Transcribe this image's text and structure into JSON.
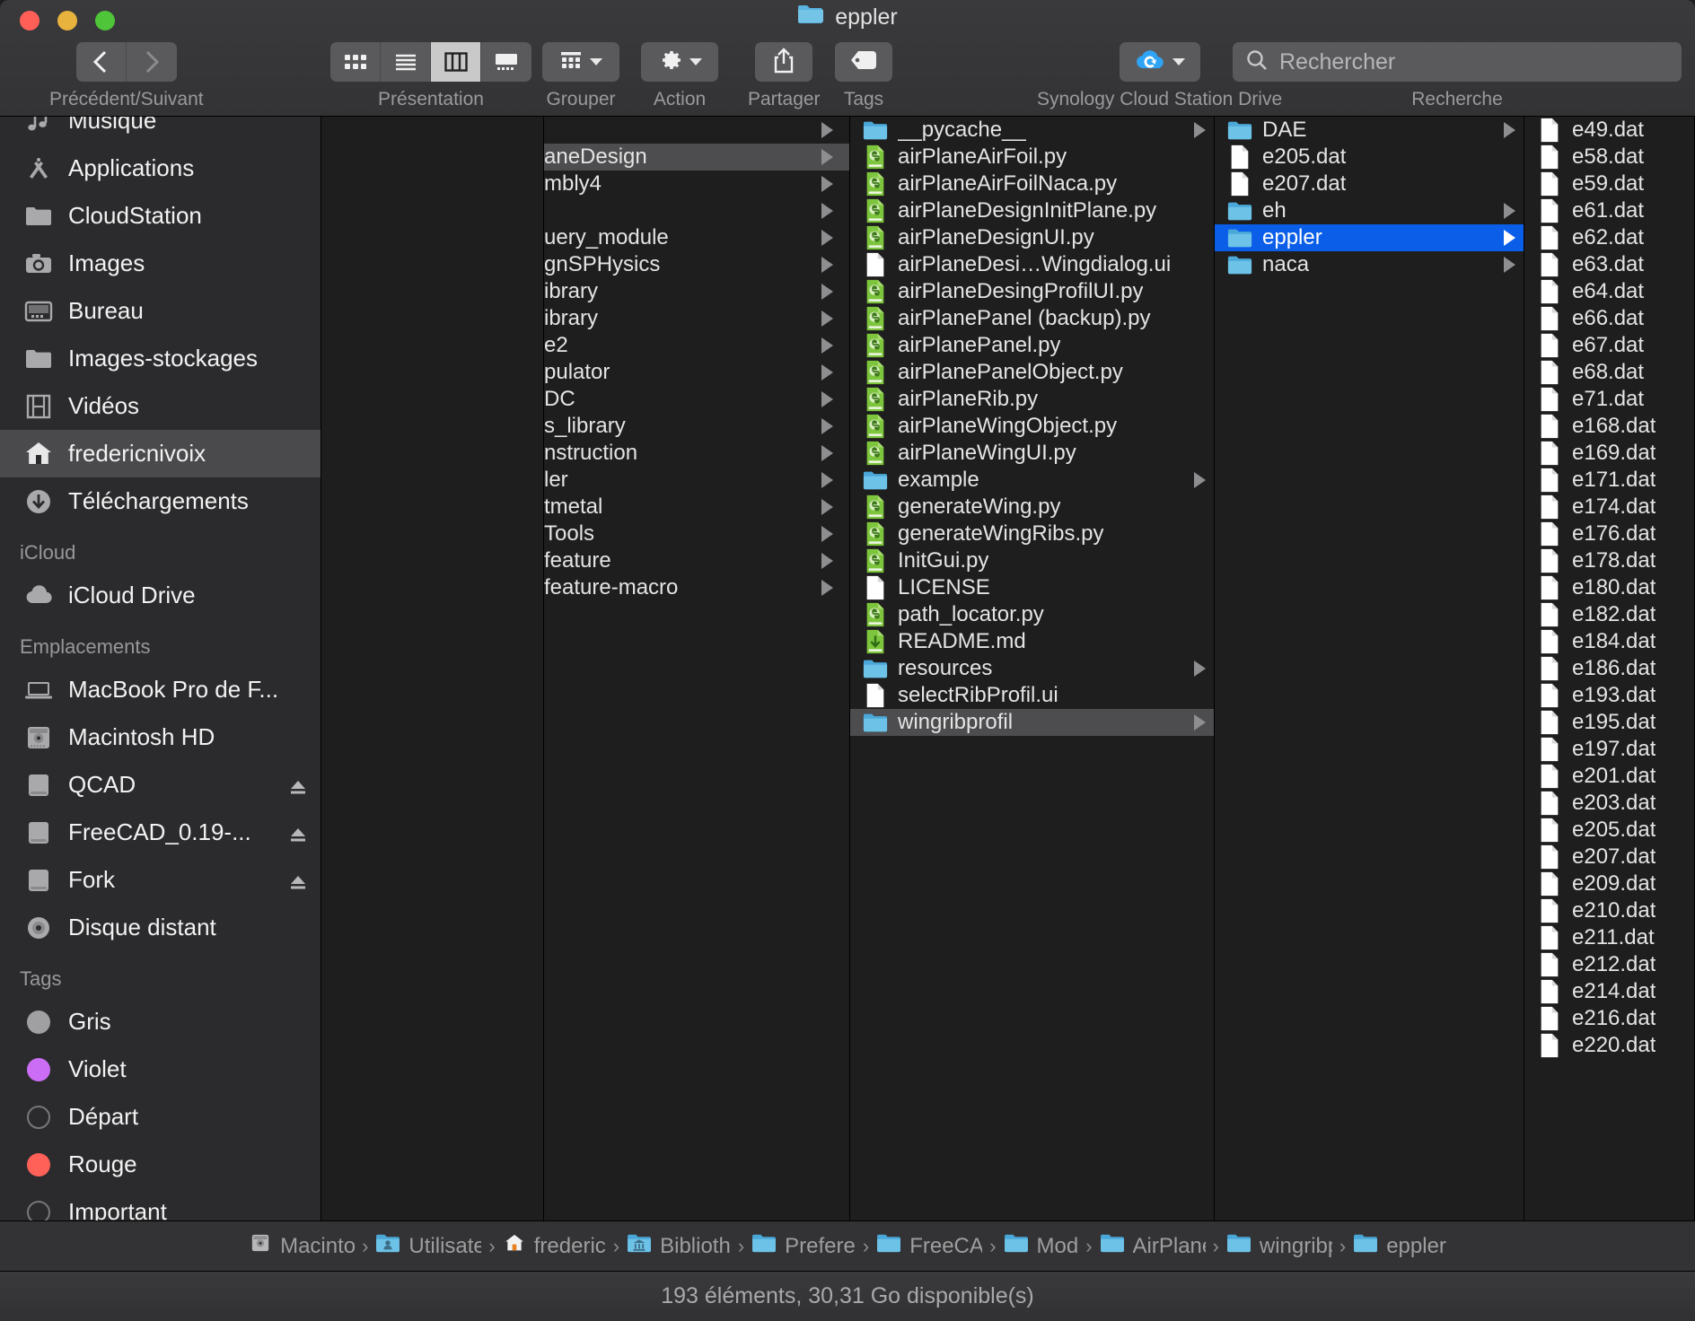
{
  "window": {
    "title": "eppler",
    "title_icon": "folder-icon"
  },
  "toolbar": {
    "nav": {
      "label": "Précédent/Suivant",
      "back_icon": "chevron-left-icon",
      "forward_icon": "chevron-right-icon"
    },
    "view": {
      "label": "Présentation",
      "options": [
        "icon-view",
        "list-view",
        "column-view",
        "gallery-view"
      ],
      "active_index": 2
    },
    "group": {
      "label": "Grouper",
      "icon": "group-grid-icon"
    },
    "action": {
      "label": "Action",
      "icon": "gear-icon"
    },
    "share": {
      "label": "Partager",
      "icon": "share-icon"
    },
    "tags": {
      "label": "Tags",
      "icon": "tag-icon"
    },
    "synology": {
      "label": "Synology Cloud Station Drive",
      "icon": "cloud-sync-icon"
    },
    "search": {
      "label": "Recherche",
      "placeholder": "Rechercher",
      "value": "",
      "icon": "search-icon"
    }
  },
  "sidebar": {
    "favorites": [
      {
        "label": "Musique",
        "icon": "music-icon",
        "selected": false
      },
      {
        "label": "Applications",
        "icon": "applications-icon",
        "selected": false
      },
      {
        "label": "CloudStation",
        "icon": "folder-icon",
        "selected": false
      },
      {
        "label": "Images",
        "icon": "camera-icon",
        "selected": false
      },
      {
        "label": "Bureau",
        "icon": "desktop-icon",
        "selected": false
      },
      {
        "label": "Images-stockages",
        "icon": "folder-icon",
        "selected": false
      },
      {
        "label": "Vidéos",
        "icon": "film-icon",
        "selected": false
      },
      {
        "label": "fredericnivoix",
        "icon": "home-icon",
        "selected": true
      },
      {
        "label": "Téléchargements",
        "icon": "download-icon",
        "selected": false
      }
    ],
    "icloud_header": "iCloud",
    "icloud": [
      {
        "label": "iCloud Drive",
        "icon": "cloud-icon",
        "eject": false
      }
    ],
    "locations_header": "Emplacements",
    "locations": [
      {
        "label": "MacBook Pro de F...",
        "icon": "laptop-icon",
        "eject": false
      },
      {
        "label": "Macintosh HD",
        "icon": "harddisk-icon",
        "eject": false
      },
      {
        "label": "QCAD",
        "icon": "drive-icon",
        "eject": true
      },
      {
        "label": "FreeCAD_0.19-...",
        "icon": "drive-icon",
        "eject": true
      },
      {
        "label": "Fork",
        "icon": "drive-icon",
        "eject": true
      },
      {
        "label": "Disque distant",
        "icon": "disc-icon",
        "eject": false
      }
    ],
    "tags_header": "Tags",
    "tags": [
      {
        "label": "Gris",
        "color": "#a0a0a2"
      },
      {
        "label": "Violet",
        "color": "#cb6ef5"
      },
      {
        "label": "Départ",
        "color": "none"
      },
      {
        "label": "Rouge",
        "color": "#ff6159"
      },
      {
        "label": "Important",
        "color": "none"
      }
    ]
  },
  "columns": [
    {
      "name": "column-1",
      "items": []
    },
    {
      "name": "column-2",
      "items": [
        {
          "label": "",
          "type": "folder",
          "arrow": true,
          "selected": false
        },
        {
          "label": "aneDesign",
          "type": "folder",
          "arrow": true,
          "selected": true
        },
        {
          "label": "mbly4",
          "type": "folder",
          "arrow": true,
          "selected": false
        },
        {
          "label": "",
          "type": "folder",
          "arrow": true,
          "selected": false
        },
        {
          "label": "uery_module",
          "type": "folder",
          "arrow": true,
          "selected": false
        },
        {
          "label": "gnSPHysics",
          "type": "folder",
          "arrow": true,
          "selected": false
        },
        {
          "label": "ibrary",
          "type": "folder",
          "arrow": true,
          "selected": false
        },
        {
          "label": "ibrary",
          "type": "folder",
          "arrow": true,
          "selected": false
        },
        {
          "label": "e2",
          "type": "folder",
          "arrow": true,
          "selected": false
        },
        {
          "label": "pulator",
          "type": "folder",
          "arrow": true,
          "selected": false
        },
        {
          "label": "DC",
          "type": "folder",
          "arrow": true,
          "selected": false
        },
        {
          "label": "s_library",
          "type": "folder",
          "arrow": true,
          "selected": false
        },
        {
          "label": "nstruction",
          "type": "folder",
          "arrow": true,
          "selected": false
        },
        {
          "label": "ler",
          "type": "folder",
          "arrow": true,
          "selected": false
        },
        {
          "label": "tmetal",
          "type": "folder",
          "arrow": true,
          "selected": false
        },
        {
          "label": "Tools",
          "type": "folder",
          "arrow": true,
          "selected": false
        },
        {
          "label": "feature",
          "type": "folder",
          "arrow": true,
          "selected": false
        },
        {
          "label": "feature-macro",
          "type": "folder",
          "arrow": true,
          "selected": false
        }
      ]
    },
    {
      "name": "column-3",
      "items": [
        {
          "label": "__pycache__",
          "type": "folder",
          "arrow": true,
          "selected": false
        },
        {
          "label": "airPlaneAirFoil.py",
          "type": "python",
          "arrow": false,
          "selected": false
        },
        {
          "label": "airPlaneAirFoilNaca.py",
          "type": "python",
          "arrow": false,
          "selected": false
        },
        {
          "label": "airPlaneDesignInitPlane.py",
          "type": "python",
          "arrow": false,
          "selected": false
        },
        {
          "label": "airPlaneDesignUI.py",
          "type": "python",
          "arrow": false,
          "selected": false
        },
        {
          "label": "airPlaneDesi…Wingdialog.ui",
          "type": "doc",
          "arrow": false,
          "selected": false
        },
        {
          "label": "airPlaneDesingProfilUI.py",
          "type": "python",
          "arrow": false,
          "selected": false
        },
        {
          "label": "airPlanePanel (backup).py",
          "type": "python",
          "arrow": false,
          "selected": false
        },
        {
          "label": "airPlanePanel.py",
          "type": "python",
          "arrow": false,
          "selected": false
        },
        {
          "label": "airPlanePanelObject.py",
          "type": "python",
          "arrow": false,
          "selected": false
        },
        {
          "label": "airPlaneRib.py",
          "type": "python",
          "arrow": false,
          "selected": false
        },
        {
          "label": "airPlaneWingObject.py",
          "type": "python",
          "arrow": false,
          "selected": false
        },
        {
          "label": "airPlaneWingUI.py",
          "type": "python",
          "arrow": false,
          "selected": false
        },
        {
          "label": "example",
          "type": "folder",
          "arrow": true,
          "selected": false
        },
        {
          "label": "generateWing.py",
          "type": "python",
          "arrow": false,
          "selected": false
        },
        {
          "label": "generateWingRibs.py",
          "type": "python",
          "arrow": false,
          "selected": false
        },
        {
          "label": "InitGui.py",
          "type": "python",
          "arrow": false,
          "selected": false
        },
        {
          "label": "LICENSE",
          "type": "doc",
          "arrow": false,
          "selected": false
        },
        {
          "label": "path_locator.py",
          "type": "python",
          "arrow": false,
          "selected": false
        },
        {
          "label": "README.md",
          "type": "markdown",
          "arrow": false,
          "selected": false
        },
        {
          "label": "resources",
          "type": "folder",
          "arrow": true,
          "selected": false
        },
        {
          "label": "selectRibProfil.ui",
          "type": "doc",
          "arrow": false,
          "selected": false
        },
        {
          "label": "wingribprofil",
          "type": "folder",
          "arrow": true,
          "selected": true
        }
      ]
    },
    {
      "name": "column-4",
      "items": [
        {
          "label": "DAE",
          "type": "folder",
          "arrow": true,
          "selected": false
        },
        {
          "label": "e205.dat",
          "type": "doc",
          "arrow": false,
          "selected": false
        },
        {
          "label": "e207.dat",
          "type": "doc",
          "arrow": false,
          "selected": false
        },
        {
          "label": "eh",
          "type": "folder",
          "arrow": true,
          "selected": false
        },
        {
          "label": "eppler",
          "type": "folder",
          "arrow": true,
          "selected": true,
          "highlight": "blue"
        },
        {
          "label": "naca",
          "type": "folder",
          "arrow": true,
          "selected": false
        }
      ]
    },
    {
      "name": "column-5",
      "items": [
        {
          "label": "e49.dat",
          "type": "doc",
          "arrow": false,
          "selected": false
        },
        {
          "label": "e58.dat",
          "type": "doc",
          "arrow": false,
          "selected": false
        },
        {
          "label": "e59.dat",
          "type": "doc",
          "arrow": false,
          "selected": false
        },
        {
          "label": "e61.dat",
          "type": "doc",
          "arrow": false,
          "selected": false
        },
        {
          "label": "e62.dat",
          "type": "doc",
          "arrow": false,
          "selected": false
        },
        {
          "label": "e63.dat",
          "type": "doc",
          "arrow": false,
          "selected": false
        },
        {
          "label": "e64.dat",
          "type": "doc",
          "arrow": false,
          "selected": false
        },
        {
          "label": "e66.dat",
          "type": "doc",
          "arrow": false,
          "selected": false
        },
        {
          "label": "e67.dat",
          "type": "doc",
          "arrow": false,
          "selected": false
        },
        {
          "label": "e68.dat",
          "type": "doc",
          "arrow": false,
          "selected": false
        },
        {
          "label": "e71.dat",
          "type": "doc",
          "arrow": false,
          "selected": false
        },
        {
          "label": "e168.dat",
          "type": "doc",
          "arrow": false,
          "selected": false
        },
        {
          "label": "e169.dat",
          "type": "doc",
          "arrow": false,
          "selected": false
        },
        {
          "label": "e171.dat",
          "type": "doc",
          "arrow": false,
          "selected": false
        },
        {
          "label": "e174.dat",
          "type": "doc",
          "arrow": false,
          "selected": false
        },
        {
          "label": "e176.dat",
          "type": "doc",
          "arrow": false,
          "selected": false
        },
        {
          "label": "e178.dat",
          "type": "doc",
          "arrow": false,
          "selected": false
        },
        {
          "label": "e180.dat",
          "type": "doc",
          "arrow": false,
          "selected": false
        },
        {
          "label": "e182.dat",
          "type": "doc",
          "arrow": false,
          "selected": false
        },
        {
          "label": "e184.dat",
          "type": "doc",
          "arrow": false,
          "selected": false
        },
        {
          "label": "e186.dat",
          "type": "doc",
          "arrow": false,
          "selected": false
        },
        {
          "label": "e193.dat",
          "type": "doc",
          "arrow": false,
          "selected": false
        },
        {
          "label": "e195.dat",
          "type": "doc",
          "arrow": false,
          "selected": false
        },
        {
          "label": "e197.dat",
          "type": "doc",
          "arrow": false,
          "selected": false
        },
        {
          "label": "e201.dat",
          "type": "doc",
          "arrow": false,
          "selected": false
        },
        {
          "label": "e203.dat",
          "type": "doc",
          "arrow": false,
          "selected": false
        },
        {
          "label": "e205.dat",
          "type": "doc",
          "arrow": false,
          "selected": false
        },
        {
          "label": "e207.dat",
          "type": "doc",
          "arrow": false,
          "selected": false
        },
        {
          "label": "e209.dat",
          "type": "doc",
          "arrow": false,
          "selected": false
        },
        {
          "label": "e210.dat",
          "type": "doc",
          "arrow": false,
          "selected": false
        },
        {
          "label": "e211.dat",
          "type": "doc",
          "arrow": false,
          "selected": false
        },
        {
          "label": "e212.dat",
          "type": "doc",
          "arrow": false,
          "selected": false
        },
        {
          "label": "e214.dat",
          "type": "doc",
          "arrow": false,
          "selected": false
        },
        {
          "label": "e216.dat",
          "type": "doc",
          "arrow": false,
          "selected": false
        },
        {
          "label": "e220.dat",
          "type": "doc",
          "arrow": false,
          "selected": false
        }
      ]
    }
  ],
  "pathbar": [
    {
      "label": "Macintosh HD",
      "icon": "harddisk-icon"
    },
    {
      "label": "Utilisate",
      "icon": "users-folder-icon"
    },
    {
      "label": "frederic",
      "icon": "home-icon"
    },
    {
      "label": "Biblioth",
      "icon": "library-folder-icon"
    },
    {
      "label": "Prefere",
      "icon": "folder-icon"
    },
    {
      "label": "FreeCA",
      "icon": "folder-icon"
    },
    {
      "label": "Mod",
      "icon": "folder-icon"
    },
    {
      "label": "AirPlane",
      "icon": "folder-icon"
    },
    {
      "label": "wingribprofil",
      "icon": "folder-icon"
    },
    {
      "label": "eppler",
      "icon": "folder-icon"
    }
  ],
  "statusbar": {
    "text": "193 éléments, 30,31 Go disponible(s)"
  },
  "colors": {
    "selection_blue": "#0a5ee8",
    "selection_gray": "#4d4d4f",
    "folder_blue": "#5ab4e0",
    "python_green": "#6cbf2a"
  }
}
